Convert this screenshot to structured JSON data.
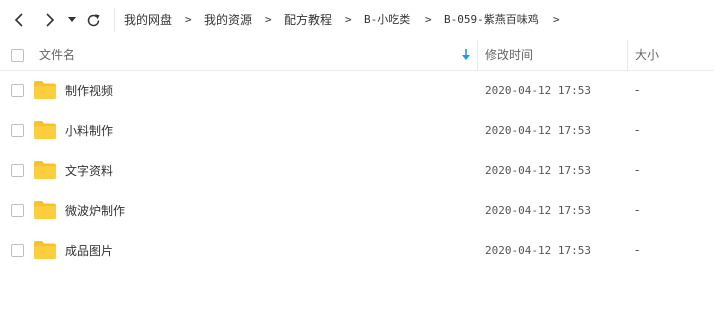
{
  "nav": {
    "back_icon": "chevron-left-icon",
    "forward_icon": "chevron-right-icon",
    "history_icon": "caret-down-icon",
    "refresh_icon": "refresh-icon"
  },
  "breadcrumb": {
    "items": [
      "我的网盘",
      "我的资源",
      "配方教程",
      "B-小吃类",
      "B-059-紫燕百味鸡"
    ],
    "separator": ">"
  },
  "table": {
    "columns": {
      "name": "文件名",
      "modified": "修改时间",
      "size": "大小"
    },
    "sort_icon": "sort-down-arrow-icon",
    "sort_color": "#1a9bf0",
    "folder_color": "#f7c12b",
    "rows": [
      {
        "name": "制作视频",
        "modified": "2020-04-12 17:53",
        "size": "-"
      },
      {
        "name": "小料制作",
        "modified": "2020-04-12 17:53",
        "size": "-"
      },
      {
        "name": "文字资料",
        "modified": "2020-04-12 17:53",
        "size": "-"
      },
      {
        "name": "微波炉制作",
        "modified": "2020-04-12 17:53",
        "size": "-"
      },
      {
        "name": "成品图片",
        "modified": "2020-04-12 17:53",
        "size": "-"
      }
    ]
  }
}
